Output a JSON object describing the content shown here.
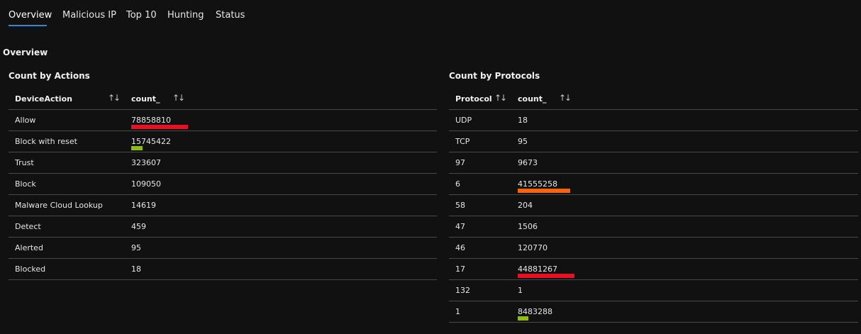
{
  "tabs": [
    {
      "label": "Overview",
      "active": true
    },
    {
      "label": "Malicious IP",
      "active": false
    },
    {
      "label": "Top 10",
      "active": false
    },
    {
      "label": "Hunting",
      "active": false
    },
    {
      "label": "Status",
      "active": false
    }
  ],
  "section_title": "Overview",
  "actions_panel": {
    "title": "Count by Actions",
    "columns": [
      "DeviceAction",
      "count_"
    ],
    "sort_icon": "↑↓",
    "rows": [
      {
        "label": "Allow",
        "count": "78858810",
        "bar_fraction": 1.0,
        "bar_color": "#e81123"
      },
      {
        "label": "Block with reset",
        "count": "15745422",
        "bar_fraction": 0.2,
        "bar_color": "#8cbd18"
      },
      {
        "label": "Trust",
        "count": "323607",
        "bar_fraction": 0,
        "bar_color": ""
      },
      {
        "label": "Block",
        "count": "109050",
        "bar_fraction": 0,
        "bar_color": ""
      },
      {
        "label": "Malware Cloud Lookup",
        "count": "14619",
        "bar_fraction": 0,
        "bar_color": ""
      },
      {
        "label": "Detect",
        "count": "459",
        "bar_fraction": 0,
        "bar_color": ""
      },
      {
        "label": "Alerted",
        "count": "95",
        "bar_fraction": 0,
        "bar_color": ""
      },
      {
        "label": "Blocked",
        "count": "18",
        "bar_fraction": 0,
        "bar_color": ""
      }
    ]
  },
  "protocols_panel": {
    "title": "Count by Protocols",
    "columns": [
      "Protocol",
      "count_"
    ],
    "sort_icon": "↑↓",
    "rows": [
      {
        "label": "UDP",
        "count": "18",
        "bar_fraction": 0,
        "bar_color": ""
      },
      {
        "label": "TCP",
        "count": "95",
        "bar_fraction": 0,
        "bar_color": ""
      },
      {
        "label": "97",
        "count": "9673",
        "bar_fraction": 0,
        "bar_color": ""
      },
      {
        "label": "6",
        "count": "41555258",
        "bar_fraction": 0.925,
        "bar_color": "#f7630c"
      },
      {
        "label": "58",
        "count": "204",
        "bar_fraction": 0,
        "bar_color": ""
      },
      {
        "label": "47",
        "count": "1506",
        "bar_fraction": 0,
        "bar_color": ""
      },
      {
        "label": "46",
        "count": "120770",
        "bar_fraction": 0,
        "bar_color": ""
      },
      {
        "label": "17",
        "count": "44881267",
        "bar_fraction": 1.0,
        "bar_color": "#e81123"
      },
      {
        "label": "132",
        "count": "1",
        "bar_fraction": 0,
        "bar_color": ""
      },
      {
        "label": "1",
        "count": "8483288",
        "bar_fraction": 0.19,
        "bar_color": "#8cbd18"
      }
    ]
  }
}
